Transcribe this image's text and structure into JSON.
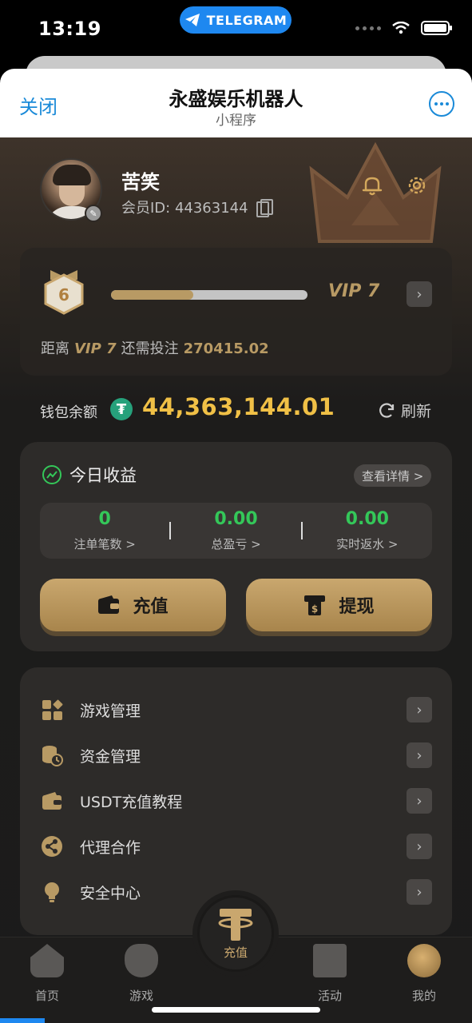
{
  "status_bar": {
    "time": "13:19",
    "telegram_label": "TELEGRAM"
  },
  "header": {
    "close_label": "关闭",
    "title": "永盛娱乐机器人",
    "subtitle": "小程序"
  },
  "profile": {
    "username": "苦笑",
    "member_id": "会员ID: 44363144"
  },
  "vip": {
    "level_badge": "6",
    "next_level_label": "VIP 7",
    "progress_fraction": 0.42,
    "info_prefix": "距离",
    "info_level": "VIP 7",
    "info_middle": "还需投注",
    "info_amount": "270415.02"
  },
  "wallet": {
    "label": "钱包余额",
    "currency_symbol": "₮",
    "amount": "44,363,144.01",
    "refresh_label": "刷新"
  },
  "earnings": {
    "title": "今日收益",
    "details_label": "查看详情 >",
    "stats": [
      {
        "value": "0",
        "label": "注单笔数 >"
      },
      {
        "value": "0.00",
        "label": "总盈亏 >"
      },
      {
        "value": "0.00",
        "label": "实时返水 >"
      }
    ],
    "recharge_label": "充值",
    "withdraw_label": "提现"
  },
  "menu": {
    "items": [
      {
        "label": "游戏管理",
        "icon": "grid-icon"
      },
      {
        "label": "资金管理",
        "icon": "coins-clock-icon"
      },
      {
        "label": "USDT充值教程",
        "icon": "wallet-icon"
      },
      {
        "label": "代理合作",
        "icon": "share-icon"
      },
      {
        "label": "安全中心",
        "icon": "lightbulb-icon"
      }
    ]
  },
  "bottom_nav": {
    "home": "首页",
    "games": "游戏",
    "center": "充值",
    "events": "活动",
    "mine": "我的"
  },
  "colors": {
    "accent_gold": "#b89a64",
    "amount_yellow": "#f0c046",
    "positive_green": "#34c759",
    "telegram_blue": "#1e88f0"
  }
}
